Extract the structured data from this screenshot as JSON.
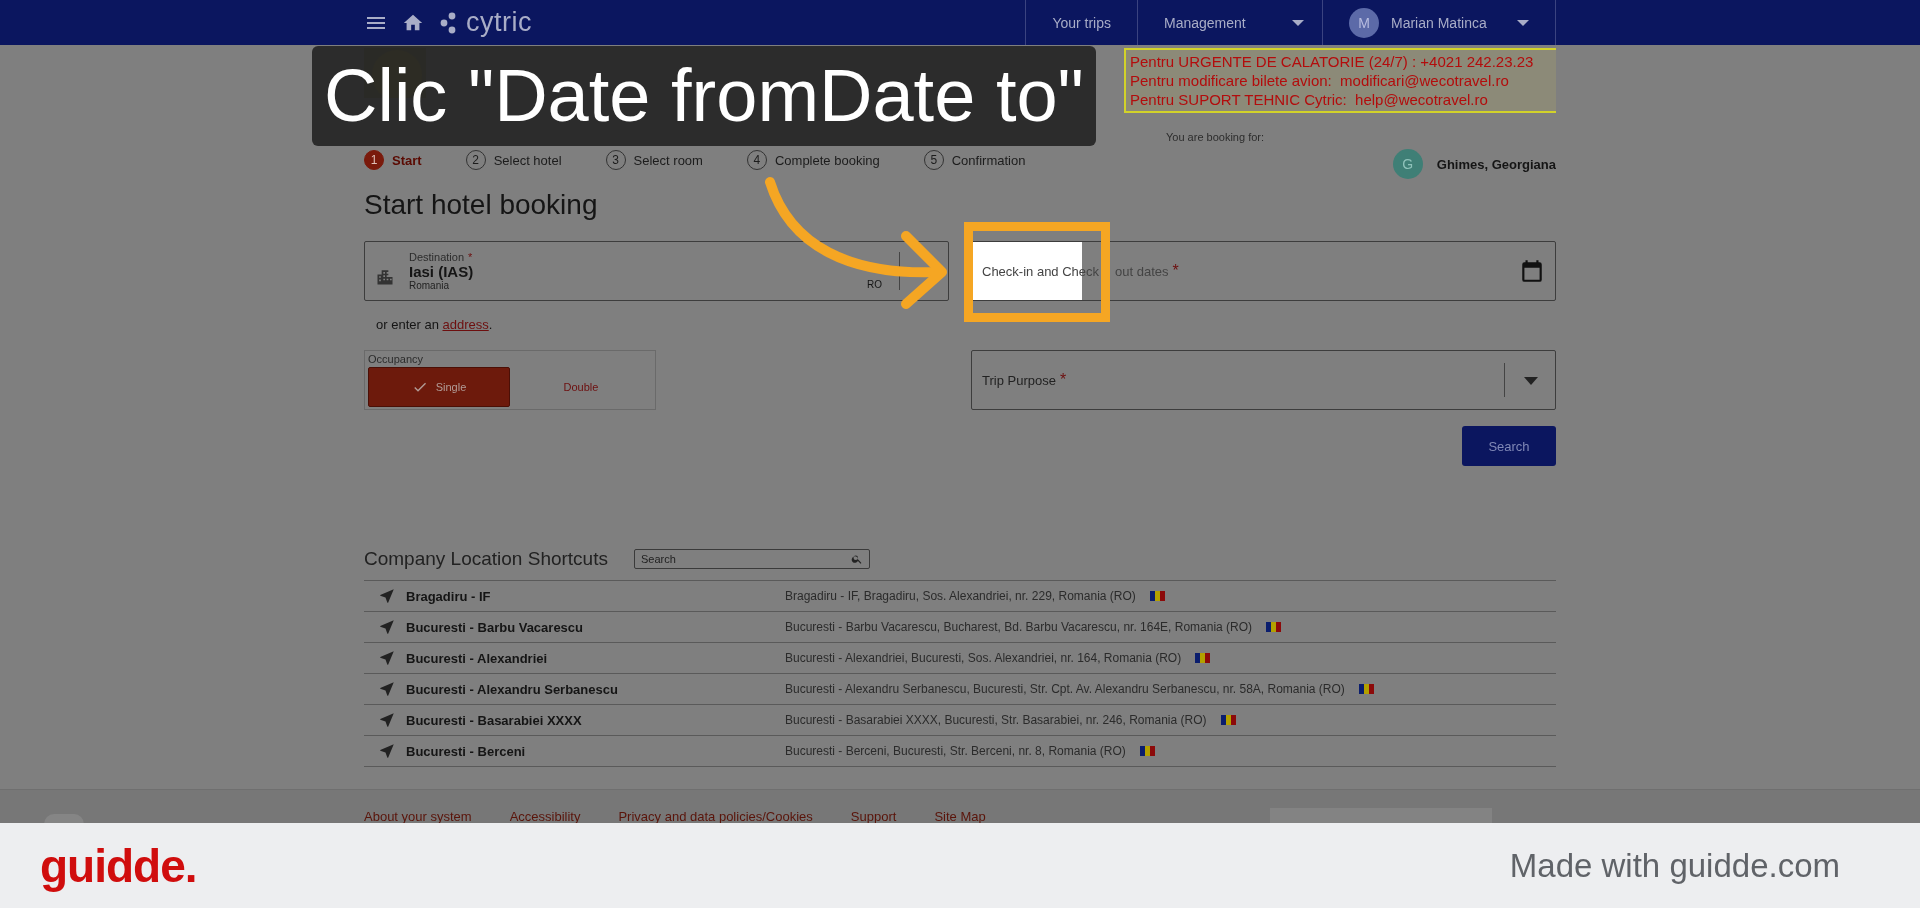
{
  "header": {
    "logo": "cytric",
    "nav": [
      {
        "label": "Your trips",
        "kind": "link"
      },
      {
        "label": "Management",
        "kind": "menu"
      }
    ],
    "user": {
      "initial": "M",
      "name": "Marian Matinca"
    }
  },
  "notice": [
    "Pentru URGENTE DE CALATORIE (24/7) : +4021 242.23.23",
    "Pentru modificare bilete avion:  modificari@wecotravel.ro",
    "Pentru SUPORT TEHNIC Cytric:  help@wecotravel.ro"
  ],
  "steps": [
    {
      "number": "1",
      "label": "Start",
      "selected": true
    },
    {
      "number": "2",
      "label": "Select hotel",
      "selected": false
    },
    {
      "number": "3",
      "label": "Select room",
      "selected": false
    },
    {
      "number": "4",
      "label": "Complete booking",
      "selected": false
    },
    {
      "number": "5",
      "label": "Confirmation",
      "selected": false
    }
  ],
  "booking_for": {
    "label": "You are booking for:",
    "initial": "G",
    "name": "Ghimes, Georgiana"
  },
  "title": "Start hotel booking",
  "destination": {
    "label": "Destination",
    "required_mark": "*",
    "value": "Iasi (IAS)",
    "country": "Romania",
    "country_code": "RO"
  },
  "address_hint": {
    "text": "or enter an",
    "link": "address",
    "after": "."
  },
  "dates": {
    "placeholder_parts": [
      "Check-in and Check",
      "out dates"
    ],
    "required_mark": "*"
  },
  "occupancy": {
    "label": "Occupancy",
    "options": [
      {
        "label": "Single",
        "selected": true
      },
      {
        "label": "Double",
        "selected": false
      }
    ]
  },
  "trip_purpose": {
    "label": "Trip Purpose",
    "required_mark": "*"
  },
  "search_button": "Search",
  "shortcuts": {
    "title": "Company Location Shortcuts",
    "search_placeholder": "Search",
    "rows": [
      {
        "name": "Bragadiru - IF",
        "address": "Bragadiru - IF, Bragadiru, Sos. Alexandriei, nr. 229, Romania (RO)"
      },
      {
        "name": "Bucuresti - Barbu Vacarescu",
        "address": "Bucuresti - Barbu Vacarescu, Bucharest, Bd. Barbu Vacarescu, nr. 164E, Romania (RO)"
      },
      {
        "name": "Bucuresti - Alexandriei",
        "address": "Bucuresti - Alexandriei, Bucuresti, Sos. Alexandriei, nr. 164, Romania (RO)"
      },
      {
        "name": "Bucuresti - Alexandru Serbanescu",
        "address": "Bucuresti - Alexandru Serbanescu, Bucuresti, Str. Cpt. Av. Alexandru Serbanescu, nr. 58A, Romania (RO)"
      },
      {
        "name": "Bucuresti - Basarabiei XXXX",
        "address": "Bucuresti - Basarabiei XXXX, Bucuresti, Str. Basarabiei, nr. 246, Romania (RO)"
      },
      {
        "name": "Bucuresti - Berceni",
        "address": "Bucuresti - Berceni, Bucuresti, Str. Berceni, nr. 8, Romania (RO)"
      }
    ]
  },
  "footer_links": [
    "About your system",
    "Accessibility",
    "Privacy and data policies/Cookies",
    "Support",
    "Site Map"
  ],
  "tutorial": {
    "caption": "Clic \"Date fromDate to\"",
    "brand": "guidde.",
    "made_with": "Made with guidde.com"
  }
}
